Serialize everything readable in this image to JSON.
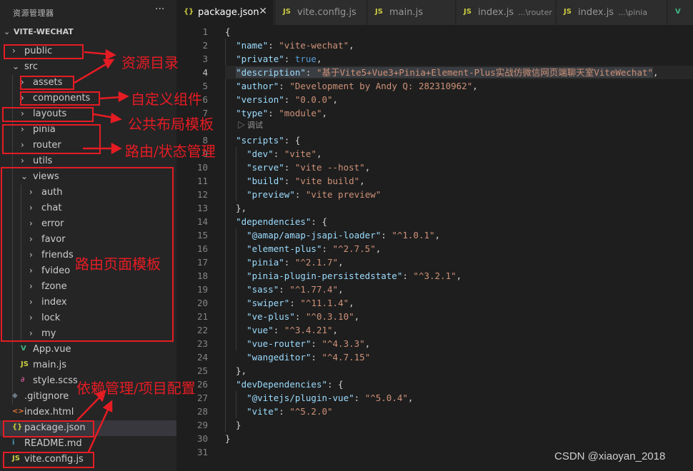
{
  "sidebar": {
    "title": "资源管理器",
    "more": "···",
    "project": "VITE-WECHAT",
    "items": [
      {
        "label": "public",
        "kind": "folder",
        "open": false,
        "depth": 0,
        "twisty": "›"
      },
      {
        "label": "src",
        "kind": "folder",
        "open": true,
        "depth": 0,
        "twisty": "⌄"
      },
      {
        "label": "assets",
        "kind": "folder",
        "open": false,
        "depth": 1,
        "twisty": "›"
      },
      {
        "label": "components",
        "kind": "folder",
        "open": false,
        "depth": 1,
        "twisty": "›"
      },
      {
        "label": "layouts",
        "kind": "folder",
        "open": false,
        "depth": 1,
        "twisty": "›"
      },
      {
        "label": "pinia",
        "kind": "folder",
        "open": false,
        "depth": 1,
        "twisty": "›"
      },
      {
        "label": "router",
        "kind": "folder",
        "open": false,
        "depth": 1,
        "twisty": "›"
      },
      {
        "label": "utils",
        "kind": "folder",
        "open": false,
        "depth": 1,
        "twisty": "›"
      },
      {
        "label": "views",
        "kind": "folder",
        "open": true,
        "depth": 1,
        "twisty": "⌄"
      },
      {
        "label": "auth",
        "kind": "folder",
        "open": false,
        "depth": 2,
        "twisty": "›"
      },
      {
        "label": "chat",
        "kind": "folder",
        "open": false,
        "depth": 2,
        "twisty": "›"
      },
      {
        "label": "error",
        "kind": "folder",
        "open": false,
        "depth": 2,
        "twisty": "›"
      },
      {
        "label": "favor",
        "kind": "folder",
        "open": false,
        "depth": 2,
        "twisty": "›"
      },
      {
        "label": "friends",
        "kind": "folder",
        "open": false,
        "depth": 2,
        "twisty": "›"
      },
      {
        "label": "fvideo",
        "kind": "folder",
        "open": false,
        "depth": 2,
        "twisty": "›"
      },
      {
        "label": "fzone",
        "kind": "folder",
        "open": false,
        "depth": 2,
        "twisty": "›"
      },
      {
        "label": "index",
        "kind": "folder",
        "open": false,
        "depth": 2,
        "twisty": "›"
      },
      {
        "label": "lock",
        "kind": "folder",
        "open": false,
        "depth": 2,
        "twisty": "›"
      },
      {
        "label": "my",
        "kind": "folder",
        "open": false,
        "depth": 2,
        "twisty": "›"
      },
      {
        "label": "App.vue",
        "kind": "file",
        "depth": 1,
        "icon": "V",
        "icon_color": "#41b883",
        "icon_name": "vue-file-icon"
      },
      {
        "label": "main.js",
        "kind": "file",
        "depth": 1,
        "icon": "JS",
        "icon_color": "#cbcb41",
        "icon_name": "js-file-icon"
      },
      {
        "label": "style.scss",
        "kind": "file",
        "depth": 1,
        "icon": "∂",
        "icon_color": "#c5568e",
        "icon_name": "scss-file-icon"
      },
      {
        "label": ".gitignore",
        "kind": "file",
        "depth": 0,
        "icon": "◆",
        "icon_color": "#6d7a86",
        "icon_name": "git-file-icon"
      },
      {
        "label": "index.html",
        "kind": "file",
        "depth": 0,
        "icon": "<>",
        "icon_color": "#e37933",
        "icon_name": "html-file-icon"
      },
      {
        "label": "package.json",
        "kind": "file",
        "depth": 0,
        "icon": "{}",
        "icon_color": "#cbcb41",
        "icon_name": "json-file-icon",
        "selected": true
      },
      {
        "label": "README.md",
        "kind": "file",
        "depth": 0,
        "icon": "i",
        "icon_color": "#519aba",
        "icon_name": "info-file-icon"
      },
      {
        "label": "vite.config.js",
        "kind": "file",
        "depth": 0,
        "icon": "JS",
        "icon_color": "#cbcb41",
        "icon_name": "js-file-icon"
      }
    ]
  },
  "tabs": [
    {
      "icon": "{}",
      "icon_color": "#cbcb41",
      "icon_name": "json-file-icon",
      "label": "package.json",
      "path": "",
      "active": true,
      "close": "✕"
    },
    {
      "icon": "JS",
      "icon_color": "#cbcb41",
      "icon_name": "js-file-icon",
      "label": "vite.config.js",
      "path": "",
      "active": false
    },
    {
      "icon": "JS",
      "icon_color": "#cbcb41",
      "icon_name": "js-file-icon",
      "label": "main.js",
      "path": "",
      "active": false
    },
    {
      "icon": "JS",
      "icon_color": "#cbcb41",
      "icon_name": "js-file-icon",
      "label": "index.js",
      "path": "...\\router",
      "active": false
    },
    {
      "icon": "JS",
      "icon_color": "#cbcb41",
      "icon_name": "js-file-icon",
      "label": "index.js",
      "path": "...\\pinia",
      "active": false
    },
    {
      "icon": "V",
      "icon_color": "#41b883",
      "icon_name": "vue-file-icon",
      "label": "",
      "path": "",
      "active": false
    }
  ],
  "editor": {
    "current_line": 4,
    "codelens": "▷ 调试",
    "lines": [
      [
        [
          "p",
          "{"
        ]
      ],
      [
        [
          "p",
          "  "
        ],
        [
          "k",
          "\"name\""
        ],
        [
          "p",
          ": "
        ],
        [
          "s",
          "\"vite-wechat\""
        ],
        [
          "p",
          ","
        ]
      ],
      [
        [
          "p",
          "  "
        ],
        [
          "k",
          "\"private\""
        ],
        [
          "p",
          ": "
        ],
        [
          "b",
          "true"
        ],
        [
          "p",
          ","
        ]
      ],
      [
        [
          "p",
          "  "
        ],
        [
          "k",
          "\"description\""
        ],
        [
          "p",
          ": "
        ],
        [
          "s",
          "\"基于Vite5+Vue3+Pinia+Element-Plus实战仿微信网页端聊天室ViteWechat\""
        ],
        [
          "p",
          ","
        ]
      ],
      [
        [
          "p",
          "  "
        ],
        [
          "k",
          "\"author\""
        ],
        [
          "p",
          ": "
        ],
        [
          "s",
          "\"Development by Andy Q: 282310962\""
        ],
        [
          "p",
          ","
        ]
      ],
      [
        [
          "p",
          "  "
        ],
        [
          "k",
          "\"version\""
        ],
        [
          "p",
          ": "
        ],
        [
          "s",
          "\"0.0.0\""
        ],
        [
          "p",
          ","
        ]
      ],
      [
        [
          "p",
          "  "
        ],
        [
          "k",
          "\"type\""
        ],
        [
          "p",
          ": "
        ],
        [
          "s",
          "\"module\""
        ],
        [
          "p",
          ","
        ]
      ],
      [
        [
          "p",
          "  "
        ],
        [
          "k",
          "\"scripts\""
        ],
        [
          "p",
          ": {"
        ]
      ],
      [
        [
          "p",
          "    "
        ],
        [
          "k",
          "\"dev\""
        ],
        [
          "p",
          ": "
        ],
        [
          "s",
          "\"vite\""
        ],
        [
          "p",
          ","
        ]
      ],
      [
        [
          "p",
          "    "
        ],
        [
          "k",
          "\"serve\""
        ],
        [
          "p",
          ": "
        ],
        [
          "s",
          "\"vite --host\""
        ],
        [
          "p",
          ","
        ]
      ],
      [
        [
          "p",
          "    "
        ],
        [
          "k",
          "\"build\""
        ],
        [
          "p",
          ": "
        ],
        [
          "s",
          "\"vite build\""
        ],
        [
          "p",
          ","
        ]
      ],
      [
        [
          "p",
          "    "
        ],
        [
          "k",
          "\"preview\""
        ],
        [
          "p",
          ": "
        ],
        [
          "s",
          "\"vite preview\""
        ]
      ],
      [
        [
          "p",
          "  },"
        ]
      ],
      [
        [
          "p",
          "  "
        ],
        [
          "k",
          "\"dependencies\""
        ],
        [
          "p",
          ": {"
        ]
      ],
      [
        [
          "p",
          "    "
        ],
        [
          "k",
          "\"@amap/amap-jsapi-loader\""
        ],
        [
          "p",
          ": "
        ],
        [
          "s",
          "\"^1.0.1\""
        ],
        [
          "p",
          ","
        ]
      ],
      [
        [
          "p",
          "    "
        ],
        [
          "k",
          "\"element-plus\""
        ],
        [
          "p",
          ": "
        ],
        [
          "s",
          "\"^2.7.5\""
        ],
        [
          "p",
          ","
        ]
      ],
      [
        [
          "p",
          "    "
        ],
        [
          "k",
          "\"pinia\""
        ],
        [
          "p",
          ": "
        ],
        [
          "s",
          "\"^2.1.7\""
        ],
        [
          "p",
          ","
        ]
      ],
      [
        [
          "p",
          "    "
        ],
        [
          "k",
          "\"pinia-plugin-persistedstate\""
        ],
        [
          "p",
          ": "
        ],
        [
          "s",
          "\"^3.2.1\""
        ],
        [
          "p",
          ","
        ]
      ],
      [
        [
          "p",
          "    "
        ],
        [
          "k",
          "\"sass\""
        ],
        [
          "p",
          ": "
        ],
        [
          "s",
          "\"^1.77.4\""
        ],
        [
          "p",
          ","
        ]
      ],
      [
        [
          "p",
          "    "
        ],
        [
          "k",
          "\"swiper\""
        ],
        [
          "p",
          ": "
        ],
        [
          "s",
          "\"^11.1.4\""
        ],
        [
          "p",
          ","
        ]
      ],
      [
        [
          "p",
          "    "
        ],
        [
          "k",
          "\"ve-plus\""
        ],
        [
          "p",
          ": "
        ],
        [
          "s",
          "\"^0.3.10\""
        ],
        [
          "p",
          ","
        ]
      ],
      [
        [
          "p",
          "    "
        ],
        [
          "k",
          "\"vue\""
        ],
        [
          "p",
          ": "
        ],
        [
          "s",
          "\"^3.4.21\""
        ],
        [
          "p",
          ","
        ]
      ],
      [
        [
          "p",
          "    "
        ],
        [
          "k",
          "\"vue-router\""
        ],
        [
          "p",
          ": "
        ],
        [
          "s",
          "\"^4.3.3\""
        ],
        [
          "p",
          ","
        ]
      ],
      [
        [
          "p",
          "    "
        ],
        [
          "k",
          "\"wangeditor\""
        ],
        [
          "p",
          ": "
        ],
        [
          "s",
          "\"^4.7.15\""
        ]
      ],
      [
        [
          "p",
          "  },"
        ]
      ],
      [
        [
          "p",
          "  "
        ],
        [
          "k",
          "\"devDependencies\""
        ],
        [
          "p",
          ": {"
        ]
      ],
      [
        [
          "p",
          "    "
        ],
        [
          "k",
          "\"@vitejs/plugin-vue\""
        ],
        [
          "p",
          ": "
        ],
        [
          "s",
          "\"^5.0.4\""
        ],
        [
          "p",
          ","
        ]
      ],
      [
        [
          "p",
          "    "
        ],
        [
          "k",
          "\"vite\""
        ],
        [
          "p",
          ": "
        ],
        [
          "s",
          "\"^5.2.0\""
        ]
      ],
      [
        [
          "p",
          "  }"
        ]
      ],
      [
        [
          "p",
          "}"
        ]
      ],
      []
    ]
  },
  "annotations": [
    {
      "name": "annotation-resource-dir",
      "text": "资源目录"
    },
    {
      "name": "annotation-custom-components",
      "text": "自定义组件"
    },
    {
      "name": "annotation-layout-templates",
      "text": "公共布局模板"
    },
    {
      "name": "annotation-router-state",
      "text": "路由/状态管理"
    },
    {
      "name": "annotation-route-pages",
      "text": "路由页面模板"
    },
    {
      "name": "annotation-deps-config",
      "text": "依赖管理/项目配置"
    }
  ],
  "watermark": "CSDN @xiaoyan_2018"
}
